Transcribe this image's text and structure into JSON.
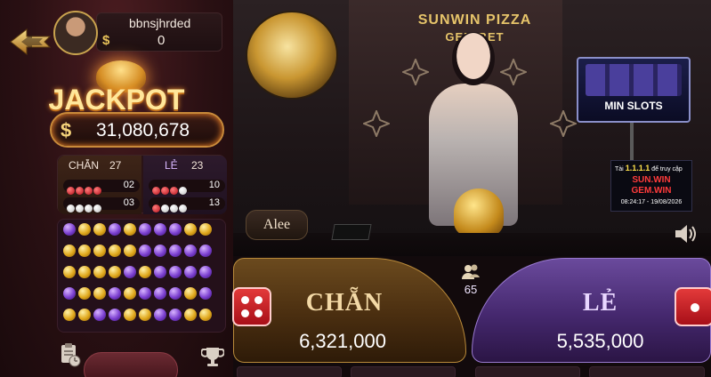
{
  "user": {
    "name": "bbnsjhrded",
    "currency_symbol": "$",
    "balance": "0"
  },
  "jackpot": {
    "title": "JACKPOT",
    "currency_symbol": "$",
    "value": "31,080,678"
  },
  "stats": {
    "chan": {
      "label": "CHẴN",
      "count": "27",
      "rows": [
        {
          "balls": [
            "red",
            "red",
            "red",
            "red"
          ],
          "count": "02"
        },
        {
          "balls": [
            "white",
            "white",
            "white",
            "white"
          ],
          "count": "03"
        }
      ]
    },
    "le": {
      "label": "LẺ",
      "count": "23",
      "rows": [
        {
          "balls": [
            "red",
            "red",
            "red",
            "white"
          ],
          "count": "10"
        },
        {
          "balls": [
            "red",
            "white",
            "white",
            "white"
          ],
          "count": "13"
        }
      ]
    }
  },
  "history": [
    [
      "purple",
      "gold",
      "gold",
      "purple",
      "gold",
      "purple",
      "purple",
      "purple",
      "gold",
      "gold"
    ],
    [
      "gold",
      "gold",
      "gold",
      "gold",
      "gold",
      "purple",
      "purple",
      "purple",
      "purple",
      "purple"
    ],
    [
      "gold",
      "gold",
      "gold",
      "gold",
      "purple",
      "gold",
      "purple",
      "purple",
      "purple",
      "purple"
    ],
    [
      "purple",
      "gold",
      "gold",
      "purple",
      "gold",
      "purple",
      "purple",
      "purple",
      "gold",
      "purple"
    ],
    [
      "gold",
      "gold",
      "purple",
      "purple",
      "gold",
      "gold",
      "purple",
      "purple",
      "gold",
      "gold"
    ]
  ],
  "stage": {
    "brand_line1": "SUNWIN PIZZA",
    "brand_line2": "GEM BET",
    "dealer_name": "Alee",
    "minslots_label": "MIN SLOTS",
    "promo": {
      "top_prefix": "Tài",
      "top_highlight": "1.1.1.1",
      "top_suffix": "để truy cập",
      "line1": "SUN.WIN",
      "line2": "GEM.WIN",
      "date": "08:24:17 - 19/08/2026"
    }
  },
  "betting": {
    "chan": {
      "label": "CHẴN",
      "amount": "6,321,000"
    },
    "le": {
      "label": "LẺ",
      "amount": "5,535,000"
    },
    "players_count": "65"
  },
  "colors": {
    "gold": "#e6c46a",
    "purple": "#7b3fd0",
    "red_dice": "#d42a2a"
  }
}
